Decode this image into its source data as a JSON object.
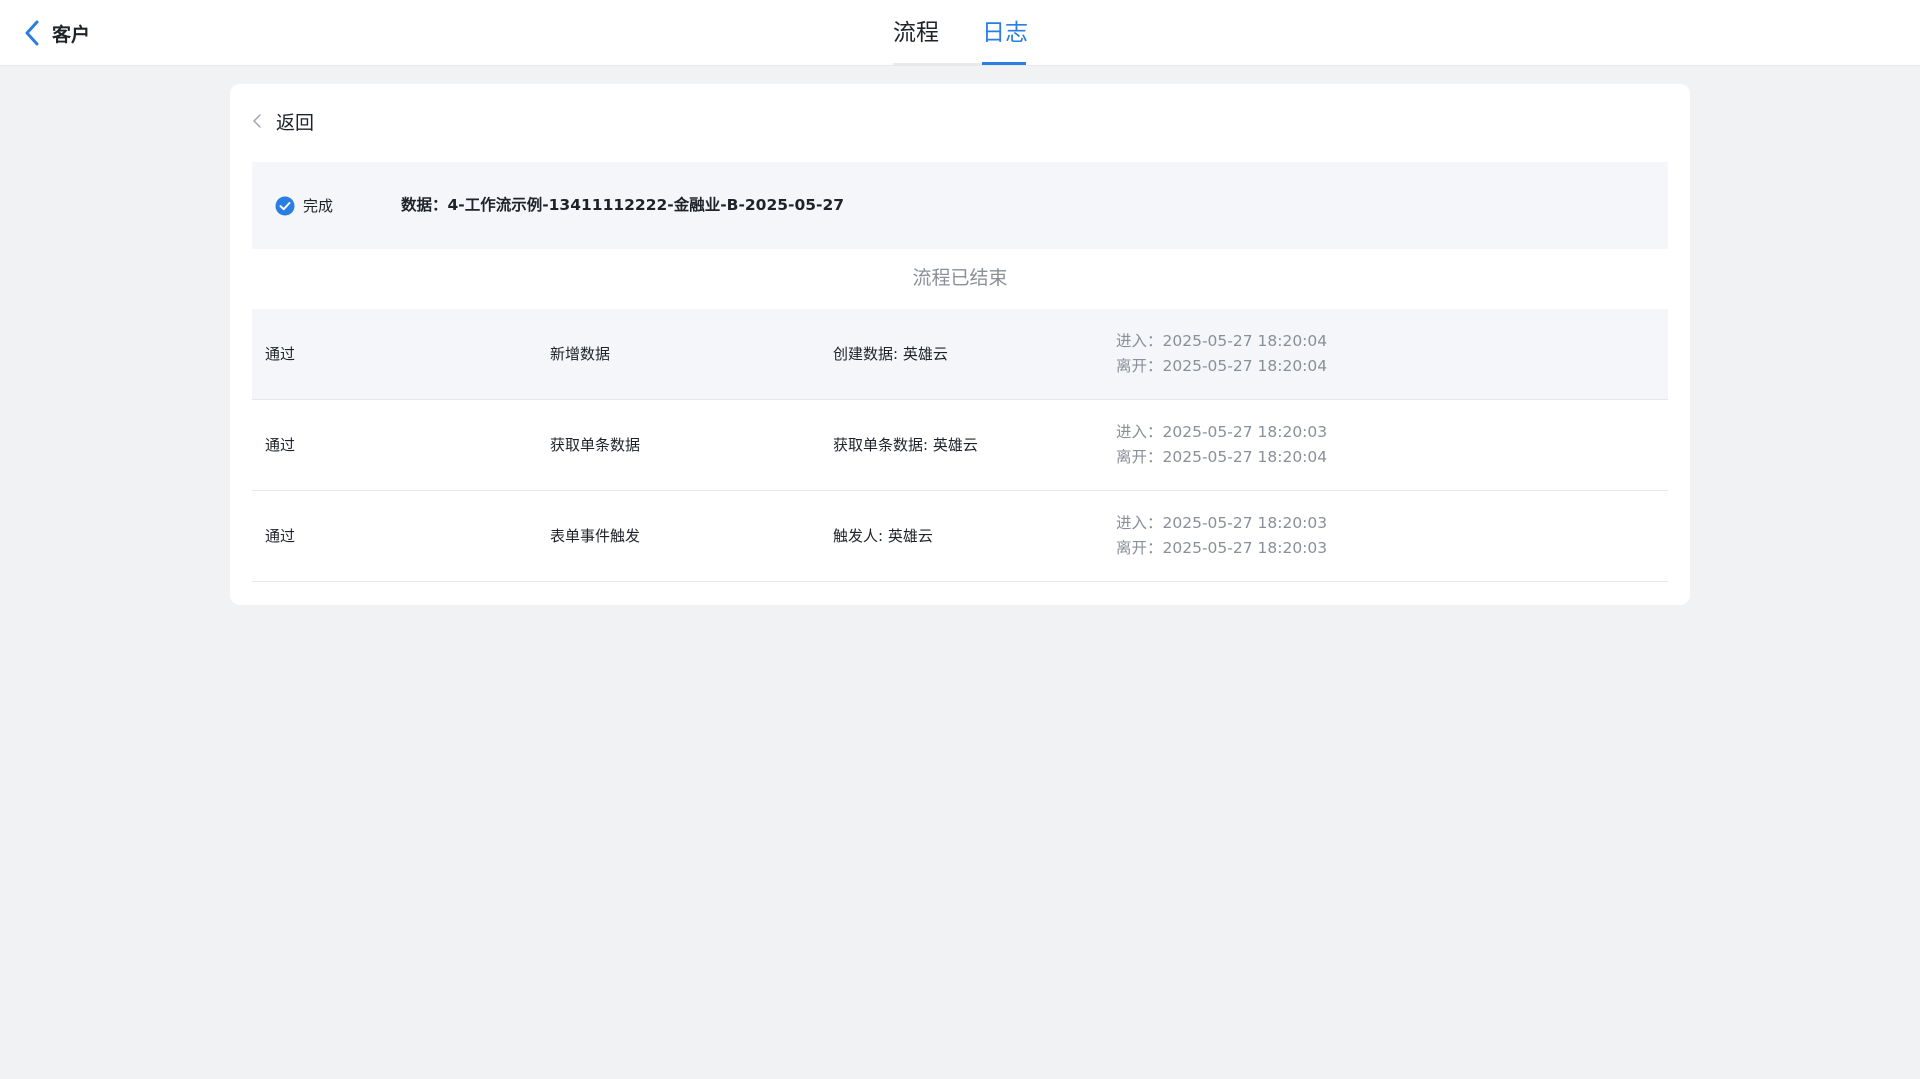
{
  "header": {
    "back_label": "客户",
    "tabs": [
      {
        "label": "流程",
        "active": false
      },
      {
        "label": "日志",
        "active": true
      }
    ]
  },
  "card": {
    "back_label": "返回",
    "status_label": "完成",
    "summary": "数据：4-工作流示例-13411112222-金融业-B-2025-05-27",
    "ended_label": "流程已结束",
    "rows": [
      {
        "result": "通过",
        "node": "新增数据",
        "detail": "创建数据: 英雄云",
        "enter": "进入：2025-05-27 18:20:04",
        "leave": "离开：2025-05-27 18:20:04"
      },
      {
        "result": "通过",
        "node": "获取单条数据",
        "detail": "获取单条数据: 英雄云",
        "enter": "进入：2025-05-27 18:20:03",
        "leave": "离开：2025-05-27 18:20:04"
      },
      {
        "result": "通过",
        "node": "表单事件触发",
        "detail": "触发人: 英雄云",
        "enter": "进入：2025-05-27 18:20:03",
        "leave": "离开：2025-05-27 18:20:03"
      }
    ]
  },
  "colors": {
    "accent": "#2a7de1",
    "page_bg": "#f1f2f4",
    "muted_text": "#8a8f98"
  }
}
